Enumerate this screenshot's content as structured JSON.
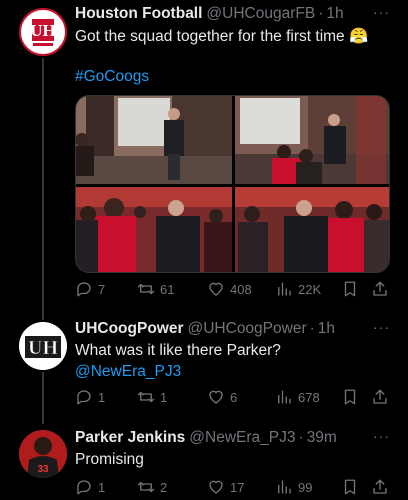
{
  "tweets": [
    {
      "name": "Houston Football",
      "handle": "@UHCougarFB",
      "dot": "·",
      "time": "1h",
      "more": "···",
      "text": "Got the squad together for the first time 😤",
      "hashtag": "#GoCoogs",
      "avatar": "uh-football-logo",
      "stats": {
        "replies": "7",
        "retweets": "61",
        "likes": "408",
        "views": "22K"
      }
    },
    {
      "name": "UHCoogPower",
      "handle": "@UHCoogPower",
      "dot": "·",
      "time": "1h",
      "more": "···",
      "text": "What was it like there Parker?",
      "mention": "@NewEra_PJ3",
      "avatar": "uh-logo-black-white",
      "stats": {
        "replies": "1",
        "retweets": "1",
        "likes": "6",
        "views": "678"
      }
    },
    {
      "name": "Parker Jenkins",
      "handle": "@NewEra_PJ3",
      "dot": "·",
      "time": "39m",
      "more": "···",
      "text": "Promising",
      "avatar": "player-photo-red-jersey",
      "stats": {
        "replies": "1",
        "retweets": "2",
        "likes": "17",
        "views": "99"
      }
    }
  ],
  "icons": {
    "reply": "reply-icon",
    "retweet": "retweet-icon",
    "like": "heart-icon",
    "views": "views-icon",
    "bookmark": "bookmark-icon",
    "share": "share-icon"
  },
  "colors": {
    "background": "#000000",
    "text": "#e7e9ea",
    "muted": "#71767b",
    "link": "#1d9bf0",
    "uh_red": "#c8102e"
  }
}
